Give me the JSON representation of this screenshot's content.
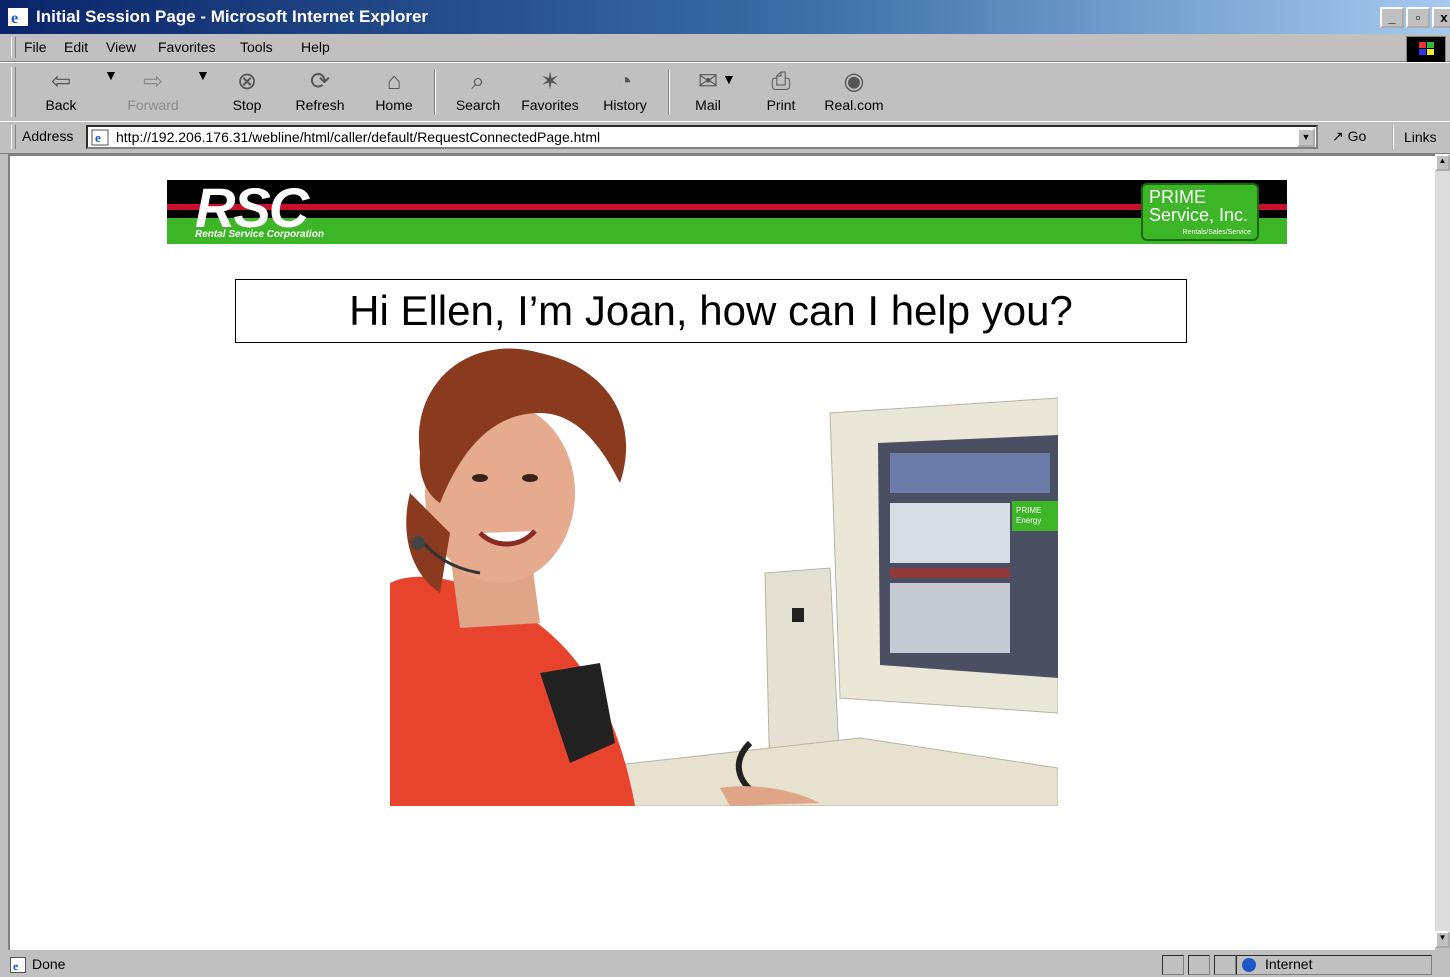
{
  "window": {
    "title": "Initial Session Page - Microsoft Internet Explorer"
  },
  "menu": {
    "items": [
      {
        "label": "File"
      },
      {
        "label": "Edit"
      },
      {
        "label": "View"
      },
      {
        "label": "Favorites"
      },
      {
        "label": "Tools"
      },
      {
        "label": "Help"
      }
    ]
  },
  "toolbar": {
    "back": "Back",
    "forward": "Forward",
    "stop": "Stop",
    "refresh": "Refresh",
    "home": "Home",
    "search": "Search",
    "favorites": "Favorites",
    "history": "History",
    "mail": "Mail",
    "print": "Print",
    "real": "Real.com"
  },
  "address": {
    "label": "Address",
    "url": "http://192.206.176.31/webline/html/caller/default/RequestConnectedPage.html",
    "go": "Go",
    "links": "Links"
  },
  "page": {
    "banner": {
      "logo": "RSC",
      "logo_subtitle": "Rental Service Corporation",
      "partner_line1": "PRIME",
      "partner_line2": "Service, Inc.",
      "partner_tagline": "Rentals/Sales/Service"
    },
    "greeting": "Hi Ellen, I’m Joan, how can I help you?",
    "monitor_badge_line1": "PRIME",
    "monitor_badge_line2": "Energy"
  },
  "status": {
    "text": "Done",
    "zone": "Internet"
  },
  "colors": {
    "titlebar": "#0a246a",
    "banner_green": "#3cb526",
    "banner_red": "#c8102e"
  }
}
